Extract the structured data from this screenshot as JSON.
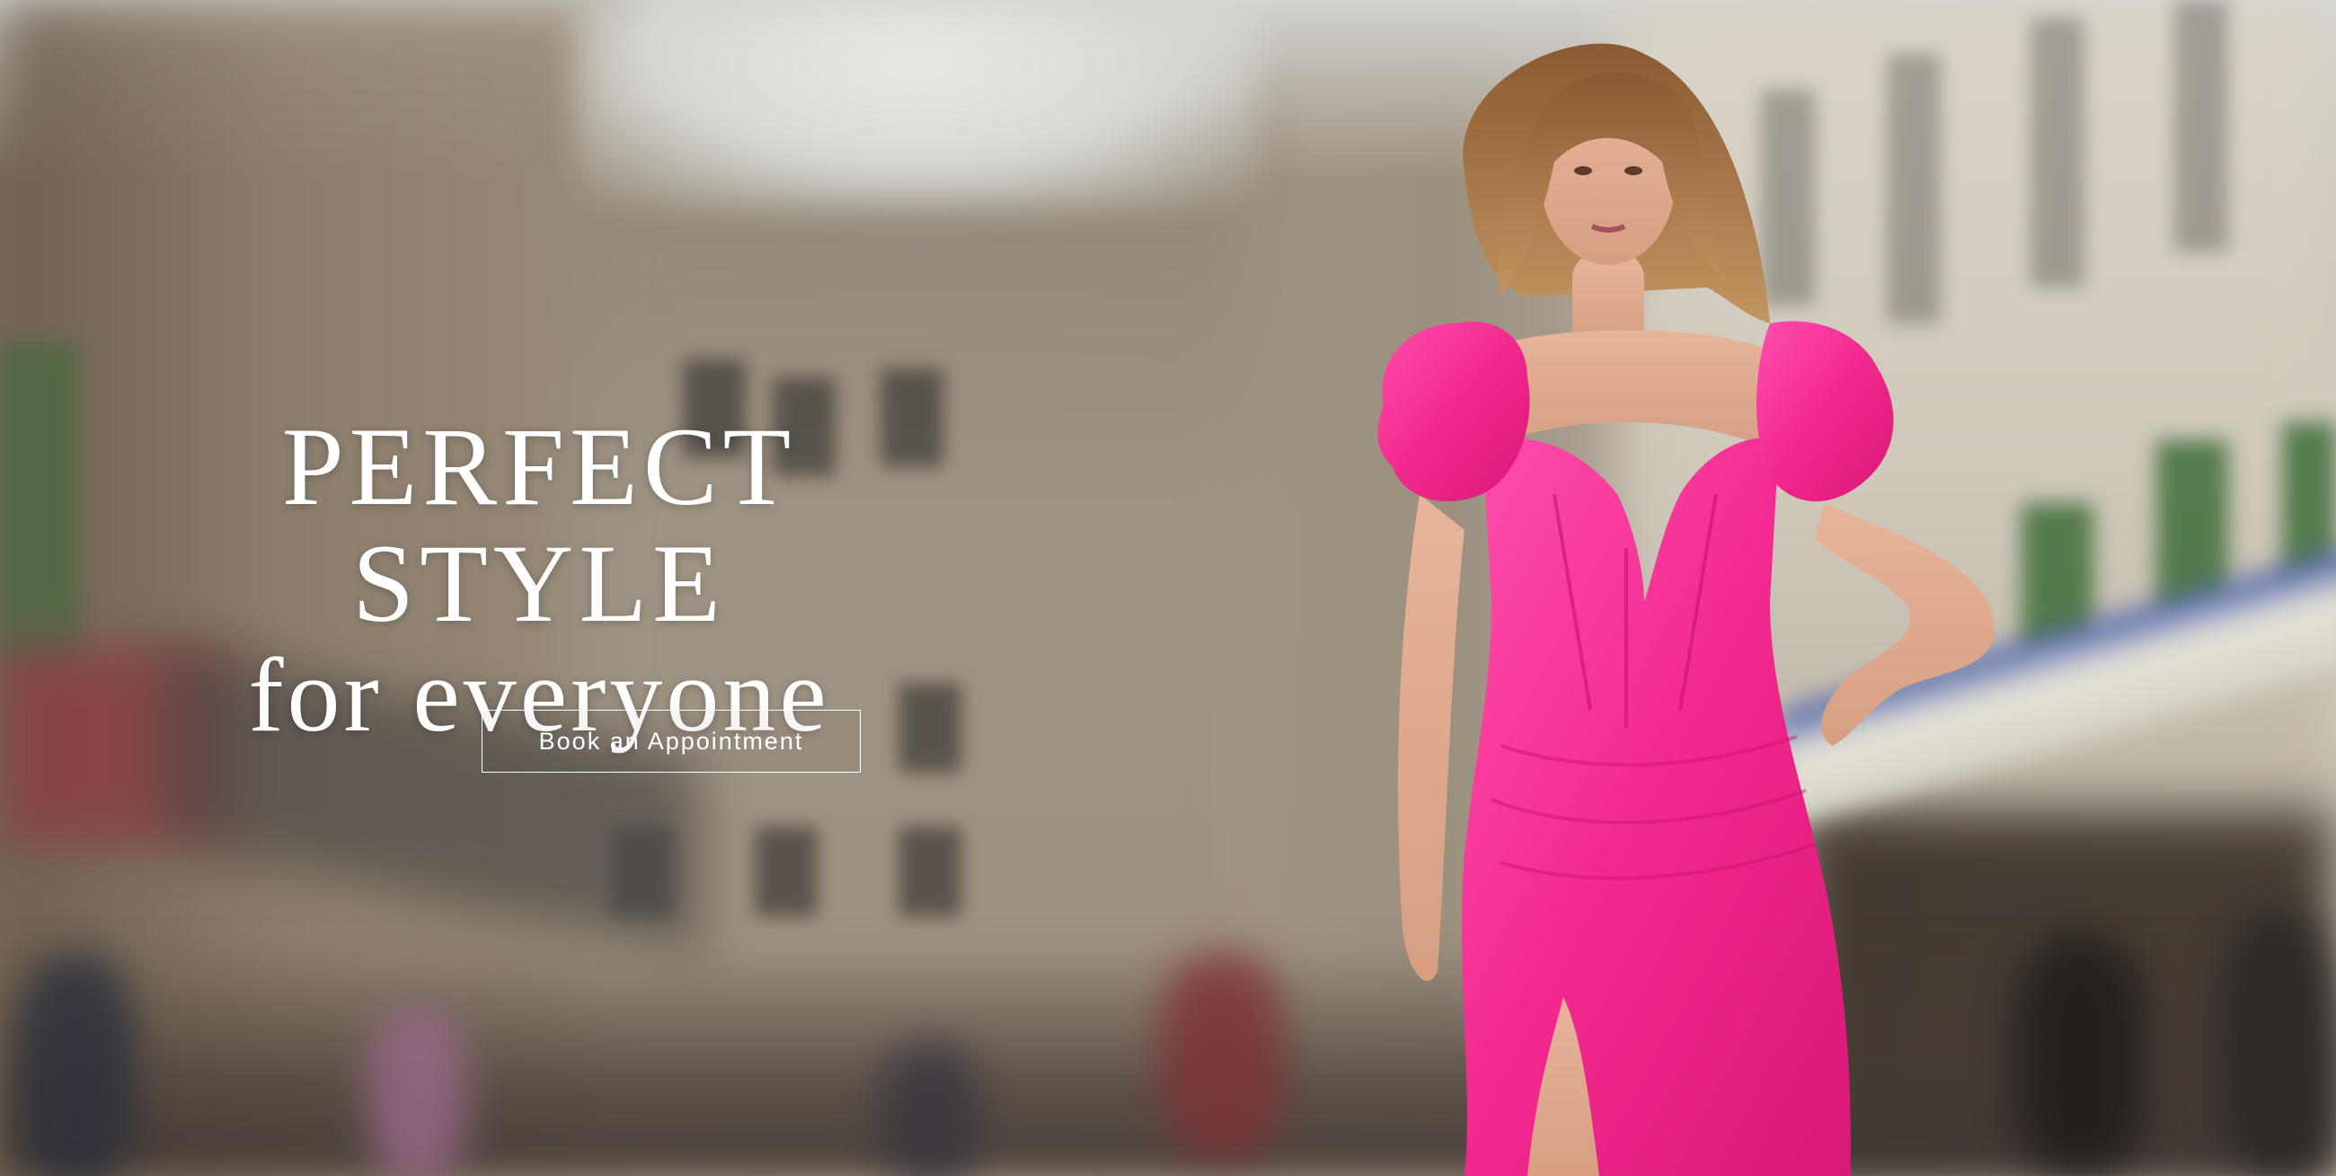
{
  "hero": {
    "headline_line1": "PERFECT STYLE",
    "headline_line2": "for everyone",
    "cta_label": "Book an Appointment",
    "colors": {
      "text": "#ffffff",
      "dress": "#f2288e",
      "button_border": "#ffffff"
    },
    "image_subject": "model-in-pink-satin-gown"
  }
}
